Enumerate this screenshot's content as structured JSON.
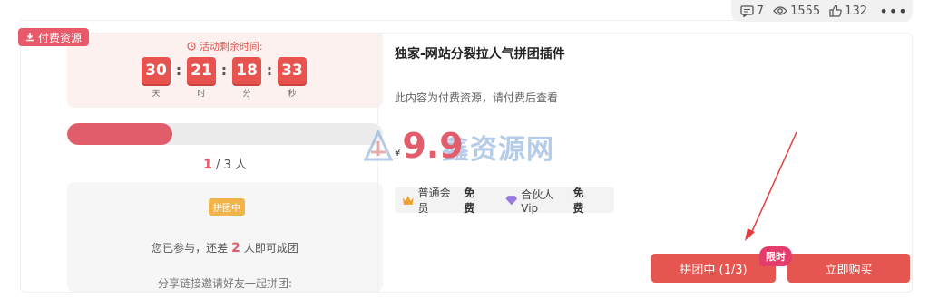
{
  "stats": {
    "comments": "7",
    "views": "1555",
    "likes": "132",
    "more": "•••"
  },
  "paid_tag": "付费资源",
  "timer": {
    "title": "活动剩余时间:",
    "days": "30",
    "hours": "21",
    "minutes": "18",
    "seconds": "33",
    "units": {
      "days": "天",
      "hours": "时",
      "minutes": "分",
      "seconds": "秒"
    }
  },
  "group": {
    "progress_fraction": 0.333,
    "current": "1",
    "total_text": "/ 3 人",
    "tag": "拼团中",
    "msg_prefix": "您已参与，还差",
    "msg_num": "2",
    "msg_suffix": "人即可成团",
    "msg2": "分享链接邀请好友一起拼团:"
  },
  "product": {
    "title": "独家-网站分裂拉人气拼团插件",
    "note": "此内容为付费资源，请付费后查看",
    "currency": "¥",
    "price": "9.9",
    "watermark": "鑫资源网",
    "vip": [
      {
        "name": "普通会员",
        "free": "免费"
      },
      {
        "name": "合伙人Vip",
        "free": "免费"
      }
    ]
  },
  "buttons": {
    "group": "拼团中 (1/3)",
    "buy": "立即购买",
    "limit": "限时"
  },
  "colors": {
    "accent": "#e25d6b",
    "button": "#e4564f",
    "timer_digit": "#e8534f",
    "tag": "#f1b44a"
  }
}
